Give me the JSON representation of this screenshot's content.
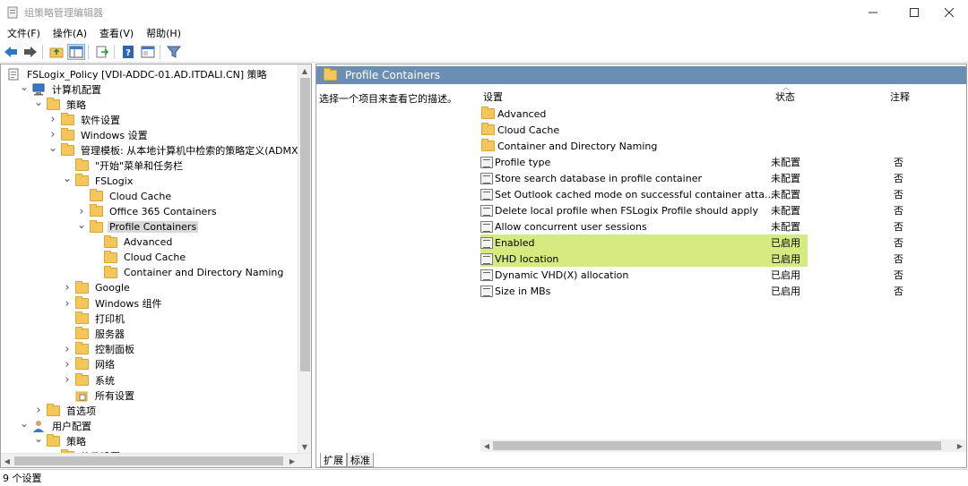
{
  "window": {
    "title": "组策略管理编辑器"
  },
  "menu": [
    "文件(F)",
    "操作(A)",
    "查看(V)",
    "帮助(H)"
  ],
  "toolbar": {
    "icons": [
      "back-icon",
      "forward-icon",
      "up-folder-icon",
      "show-hide-tree-icon",
      "export-list-icon",
      "help-icon",
      "properties-icon",
      "filter-icon"
    ]
  },
  "tree": [
    {
      "label": "FSLogix_Policy [VDI-ADDC-01.AD.ITDALI.CN] 策略",
      "level": 0,
      "expander": "",
      "icon": "policy"
    },
    {
      "label": "计算机配置",
      "level": 1,
      "expander": "open",
      "icon": "computer"
    },
    {
      "label": "策略",
      "level": 2,
      "expander": "open",
      "icon": "folder"
    },
    {
      "label": "软件设置",
      "level": 3,
      "expander": "closed",
      "icon": "folder"
    },
    {
      "label": "Windows 设置",
      "level": 3,
      "expander": "closed",
      "icon": "folder"
    },
    {
      "label": "管理模板: 从本地计算机中检索的策略定义(ADMX 文件)。",
      "level": 3,
      "expander": "open",
      "icon": "folder"
    },
    {
      "label": "\"开始\"菜单和任务栏",
      "level": 4,
      "expander": "",
      "icon": "folder"
    },
    {
      "label": "FSLogix",
      "level": 4,
      "expander": "open",
      "icon": "folder"
    },
    {
      "label": "Cloud Cache",
      "level": 5,
      "expander": "",
      "icon": "folder"
    },
    {
      "label": "Office 365 Containers",
      "level": 5,
      "expander": "closed",
      "icon": "folder"
    },
    {
      "label": "Profile Containers",
      "level": 5,
      "expander": "open",
      "icon": "folder",
      "selected": true
    },
    {
      "label": "Advanced",
      "level": 6,
      "expander": "",
      "icon": "folder"
    },
    {
      "label": "Cloud Cache",
      "level": 6,
      "expander": "",
      "icon": "folder"
    },
    {
      "label": "Container and Directory Naming",
      "level": 6,
      "expander": "",
      "icon": "folder"
    },
    {
      "label": "Google",
      "level": 4,
      "expander": "closed",
      "icon": "folder"
    },
    {
      "label": "Windows 组件",
      "level": 4,
      "expander": "closed",
      "icon": "folder"
    },
    {
      "label": "打印机",
      "level": 4,
      "expander": "",
      "icon": "folder"
    },
    {
      "label": "服务器",
      "level": 4,
      "expander": "",
      "icon": "folder"
    },
    {
      "label": "控制面板",
      "level": 4,
      "expander": "closed",
      "icon": "folder"
    },
    {
      "label": "网络",
      "level": 4,
      "expander": "closed",
      "icon": "folder"
    },
    {
      "label": "系统",
      "level": 4,
      "expander": "closed",
      "icon": "folder"
    },
    {
      "label": "所有设置",
      "level": 4,
      "expander": "",
      "icon": "all-settings"
    },
    {
      "label": "首选项",
      "level": 2,
      "expander": "closed",
      "icon": "folder"
    },
    {
      "label": "用户配置",
      "level": 1,
      "expander": "open",
      "icon": "user"
    },
    {
      "label": "策略",
      "level": 2,
      "expander": "open",
      "icon": "folder"
    },
    {
      "label": "软件设置",
      "level": 3,
      "expander": "closed",
      "icon": "folder"
    }
  ],
  "right": {
    "header_title": "Profile Containers",
    "description": "选择一个项目来查看它的描述。",
    "columns": {
      "setting": "设置",
      "state": "状态",
      "comment": "注释"
    },
    "rows": [
      {
        "name": "Advanced",
        "type": "folder",
        "state": "",
        "comment": ""
      },
      {
        "name": "Cloud Cache",
        "type": "folder",
        "state": "",
        "comment": ""
      },
      {
        "name": "Container and Directory Naming",
        "type": "folder",
        "state": "",
        "comment": ""
      },
      {
        "name": "Profile type",
        "type": "setting",
        "state": "未配置",
        "comment": "否"
      },
      {
        "name": "Store search database in profile container",
        "type": "setting",
        "state": "未配置",
        "comment": "否"
      },
      {
        "name": "Set Outlook cached mode on successful container atta...",
        "type": "setting",
        "state": "未配置",
        "comment": "否"
      },
      {
        "name": "Delete local profile when FSLogix Profile should apply",
        "type": "setting",
        "state": "未配置",
        "comment": "否"
      },
      {
        "name": "Allow concurrent user sessions",
        "type": "setting",
        "state": "未配置",
        "comment": "否"
      },
      {
        "name": "Enabled",
        "type": "setting",
        "state": "已启用",
        "comment": "否",
        "highlight": true
      },
      {
        "name": "VHD location",
        "type": "setting",
        "state": "已启用",
        "comment": "否",
        "highlight": true
      },
      {
        "name": "Dynamic VHD(X) allocation",
        "type": "setting",
        "state": "已启用",
        "comment": "否"
      },
      {
        "name": "Size in MBs",
        "type": "setting",
        "state": "已启用",
        "comment": "否"
      }
    ],
    "tabs": [
      "扩展",
      "标准"
    ]
  },
  "status": {
    "text": "9 个设置"
  },
  "colors": {
    "header_bg": "#6b8fb3",
    "highlight": "#d6eb7f",
    "folder": "#f5c65a"
  }
}
